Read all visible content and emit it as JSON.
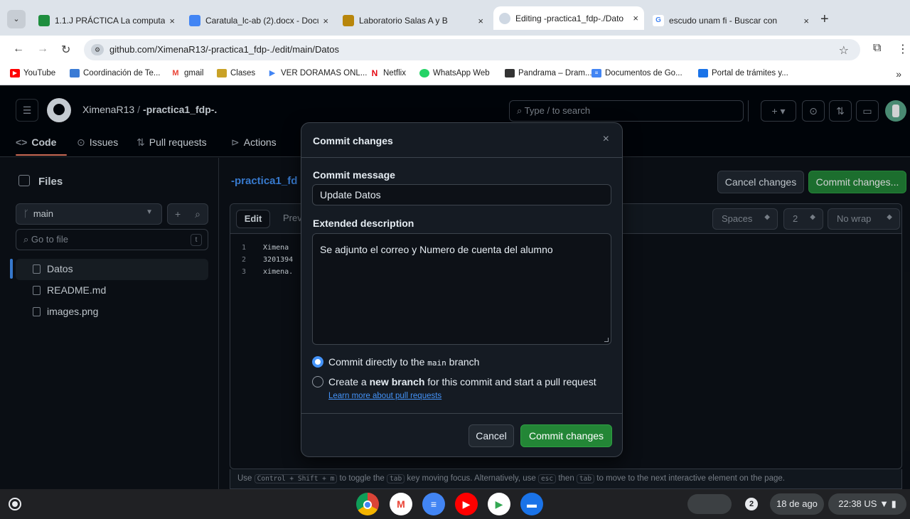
{
  "browser": {
    "tabs": [
      {
        "title": "1.1.J PRÁCTICA La computa",
        "favicon": "classroom-icon",
        "color": "#1e8e3e"
      },
      {
        "title": "Caratula_lc-ab (2).docx - Docu",
        "favicon": "docs-icon",
        "color": "#4285f4"
      },
      {
        "title": "Laboratorio Salas A y B",
        "favicon": "unam-icon",
        "color": "#b8860b"
      },
      {
        "title": "Editing -practica1_fdp-./Dato",
        "favicon": "github-icon",
        "color": "#cfd8e3"
      },
      {
        "title": "escudo unam fi - Buscar con",
        "favicon": "google-icon",
        "color": "#ffffff"
      }
    ],
    "tab_close": "×",
    "new_tab": "+",
    "url": "github.com/XimenaR13/-practica1_fdp-./edit/main/Datos",
    "bookmarks": [
      {
        "label": "YouTube",
        "color": "#ff0000"
      },
      {
        "label": "Coordinación de Te...",
        "color": "#3a7bd5"
      },
      {
        "label": "gmail",
        "color": "#ea4335"
      },
      {
        "label": "Clases",
        "color": "#c9a227"
      },
      {
        "label": "VER DORAMAS ONL...",
        "color": "#4285f4"
      },
      {
        "label": "Netflix",
        "color": "#e50914"
      },
      {
        "label": "WhatsApp Web",
        "color": "#25d366"
      },
      {
        "label": "Pandrama – Dram...",
        "color": "#333333"
      },
      {
        "label": "Documentos de Go...",
        "color": "#4285f4"
      },
      {
        "label": "Portal de trámites y...",
        "color": "#1a73e8"
      }
    ],
    "bookmarks_more": "»"
  },
  "github": {
    "owner": "XimenaR13",
    "path_sep": "/",
    "repo": "-practica1_fdp-.",
    "search_placeholder": "Type / to search",
    "repo_nav": [
      "Code",
      "Issues",
      "Pull requests",
      "Actions"
    ],
    "files_title": "Files",
    "branch": "main",
    "goto_placeholder": "Go to file",
    "goto_kbd": "t",
    "files": [
      "Datos",
      "README.md",
      "images.png"
    ],
    "crumb": "-practica1_fd",
    "cancel_changes": "Cancel changes",
    "commit_changes_top": "Commit changes...",
    "editor_tabs": [
      "Edit",
      "Prev"
    ],
    "indent_mode": "Spaces",
    "indent_size": "2",
    "wrap_mode": "No wrap",
    "code_lines": [
      {
        "num": "1",
        "text": "Ximena"
      },
      {
        "num": "2",
        "text": "3201394"
      },
      {
        "num": "3",
        "text": "ximena."
      }
    ],
    "hint": {
      "p1": "Use",
      "k1": "Control + Shift + m",
      "p2": "to toggle the",
      "k2": "tab",
      "p3": "key moving focus. Alternatively, use",
      "k3": "esc",
      "p4": "then",
      "k4": "tab",
      "p5": "to move to the next interactive element on the page."
    }
  },
  "dialog": {
    "title": "Commit changes",
    "close": "×",
    "message_label": "Commit message",
    "message_value": "Update Datos",
    "description_label": "Extended description",
    "description_value": "Se adjunto el correo y Numero de cuenta del alumno",
    "option1_pre": "Commit directly to the",
    "option1_code": "main",
    "option1_post": "branch",
    "option2_pre": "Create a",
    "option2_bold": "new branch",
    "option2_post": "for this commit and start a pull request",
    "learn_more": "Learn more about pull requests",
    "cancel": "Cancel",
    "commit": "Commit changes"
  },
  "shelf": {
    "apps": [
      {
        "name": "chrome",
        "color": "#db4437"
      },
      {
        "name": "gmail",
        "color": "#ffffff"
      },
      {
        "name": "docs",
        "color": "#4285f4"
      },
      {
        "name": "youtube",
        "color": "#ff0000"
      },
      {
        "name": "play-store",
        "color": "#ffffff"
      },
      {
        "name": "messages",
        "color": "#1a73e8"
      }
    ],
    "notification_count": "2",
    "date": "18 de ago",
    "time": "22:38 US"
  }
}
